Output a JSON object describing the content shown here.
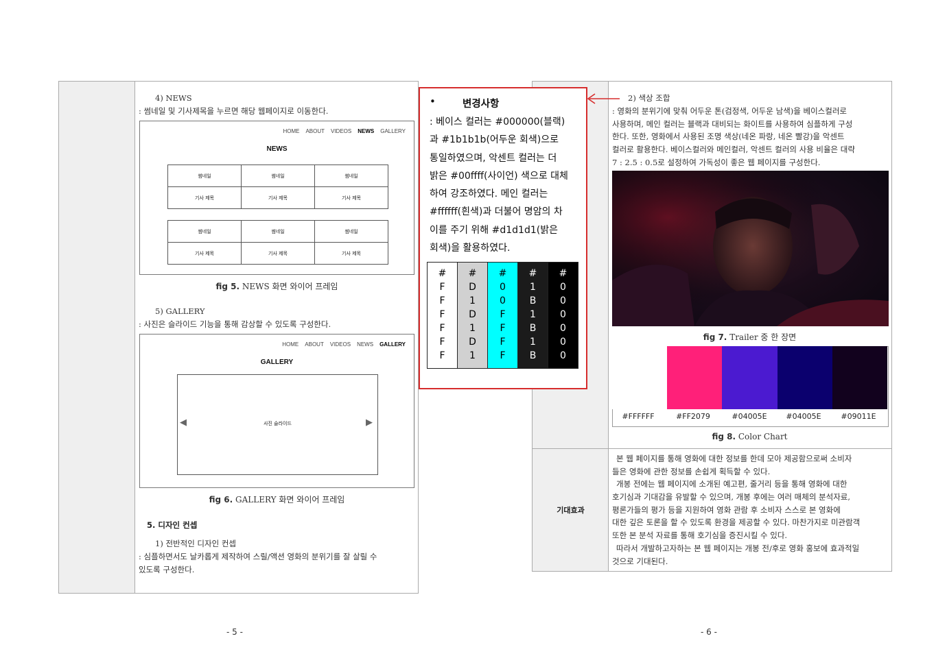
{
  "left_page": {
    "news_heading": "4) NEWS",
    "news_desc": ": 썸네일 및 기사제목을 누르면 해당 웹페이지로 이동한다.",
    "news_frame": {
      "nav": [
        "HOME",
        "ABOUT",
        "VIDEOS",
        "NEWS",
        "GALLERY"
      ],
      "title": "NEWS",
      "thumb_label": "썸네일",
      "article_label": "기사 제목"
    },
    "fig5_num": "fig 5.",
    "fig5_text": " NEWS 화면 와이어 프레임",
    "gallery_heading": "5) GALLERY",
    "gallery_desc": ": 사진은 슬라이드 기능을 통해 감상할 수 있도록 구성한다.",
    "gallery_frame": {
      "nav": [
        "HOME",
        "ABOUT",
        "VIDEOS",
        "NEWS",
        "GALLERY"
      ],
      "title": "GALLERY",
      "slide_label": "사진 슬라이드"
    },
    "fig6_num": "fig 6.",
    "fig6_text": " GALLERY 화면 와이어 프레임",
    "section5_title": "5. 디자인 컨셉",
    "concept_heading": "1) 전반적인 디자인 컨셉",
    "concept_desc_1": ": 심플하면서도 날카롭게 제작하여 스릴/액션 영화의 분위기를 잘 살릴 수",
    "concept_desc_2": "있도록 구성한다.",
    "page_number": "- 5 -"
  },
  "right_page": {
    "color_heading": "2) 색상 조합",
    "color_lines": [
      ": 영화의 분위기에 맞춰 어두운 톤(검정색, 어두운 남색)을 베이스컬러로",
      "사용하며, 메인 컬러는 블랙과 대비되는 화이트를 사용하여 심플하게 구성",
      "한다. 또한, 영화에서 사용된 조명 색상(네온 파랑, 네온 빨강)을 악센트",
      "컬러로 활용한다. 베이스컬러와 메인컬러, 악센트 컬러의 사용 비율은 대략",
      "7 : 2.5 : 0.5로 설정하여 가독성이 좋은 웹 페이지를 구성한다."
    ],
    "fig7_num": "fig 7.",
    "fig7_text": " Trailer 중 한 장면",
    "swatches": [
      {
        "hex": "#FFFFFF",
        "label": "#FFFFFF"
      },
      {
        "hex": "#FF2079",
        "label": "#FF2079"
      },
      {
        "hex": "#4B1AD0",
        "label": "#04005E"
      },
      {
        "hex": "#0B006E",
        "label": "#04005E"
      },
      {
        "hex": "#12021E",
        "label": "#09011E"
      }
    ],
    "fig8_num": "fig 8.",
    "fig8_text": " Color Chart",
    "effect_label": "기대효과",
    "effect_lines": [
      "본 웹 페이지를 통해 영화에 대한 정보를 한데 모아 제공함으로써 소비자",
      "들은 영화에 관한 정보를 손쉽게 획득할 수 있다.",
      "개봉 전에는 웹 페이지에 소개된 예고편, 줄거리 등을 통해 영화에 대한",
      "호기심과 기대감을 유발할 수 있으며, 개봉 후에는 여러 매체의 분석자료,",
      "평론가들의 평가 등을 지원하여 영화 관람 후 소비자 스스로 본 영화에",
      "대한 깊은 토론을 할 수 있도록 환경을 제공할 수 있다. 마찬가지로 미관람객",
      "또한 본 분석 자료를 통해 호기심을 증진시킬 수 있다.",
      "따라서 개발하고자하는 본 웹 페이지는 개봉 전/후로 영화 홍보에 효과적일",
      "것으로 기대된다."
    ],
    "page_number": "- 6 -"
  },
  "change_box": {
    "bullet": "•",
    "title": "변경사항",
    "lines": [
      ": 베이스 컬러는 #000000(블랙)",
      "과 #1b1b1b(어두운 회색)으로",
      "통일하였으며, 악센트 컬러는 더",
      "밝은 #00ffff(사이언) 색으로 대체",
      "하여 강조하였다. 메인 컬러는",
      "#ffffff(흰색)과 더불어 명암의 차",
      "이를 주기 위해 #d1d1d1(밝은",
      "회색)을 활용하였다."
    ],
    "colors": [
      {
        "bg": "#FFFFFF",
        "fg": "#000000",
        "chars": [
          "#",
          "F",
          "F",
          "F",
          "F",
          "F",
          "F"
        ]
      },
      {
        "bg": "#D1D1D1",
        "fg": "#000000",
        "chars": [
          "#",
          "D",
          "1",
          "D",
          "1",
          "D",
          "1"
        ]
      },
      {
        "bg": "#00FFFF",
        "fg": "#000000",
        "chars": [
          "#",
          "0",
          "0",
          "F",
          "F",
          "F",
          "F"
        ]
      },
      {
        "bg": "#1B1B1B",
        "fg": "#FFFFFF",
        "chars": [
          "#",
          "1",
          "B",
          "1",
          "B",
          "1",
          "B"
        ]
      },
      {
        "bg": "#000000",
        "fg": "#FFFFFF",
        "chars": [
          "#",
          "0",
          "0",
          "0",
          "0",
          "0",
          "0"
        ]
      }
    ],
    "border_color": "#D62C2C"
  }
}
